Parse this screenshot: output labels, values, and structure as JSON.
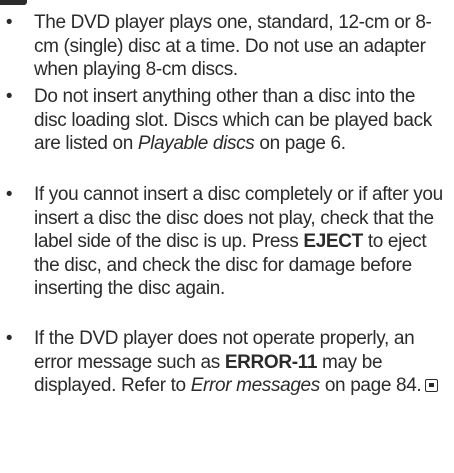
{
  "bullet_char": "•",
  "items": [
    {
      "text": "The DVD player plays one, standard, 12-cm or 8-cm (single) disc at a time. Do not use an adapter when playing 8-cm discs."
    },
    {
      "text_1": "Do not insert anything other than a disc into the disc loading slot. Discs which can be played back are listed on ",
      "ref": "Playable discs",
      "text_2": " on page 6."
    },
    {
      "text_1": "If you cannot insert a disc completely or if after you insert a disc the disc does not play, check that the label side of the disc is up. Press ",
      "bold": "EJECT",
      "text_2": " to eject the disc, and check the disc for damage before inserting the disc again."
    },
    {
      "text_1": "If the DVD player does not operate properly, an error message such as ",
      "bold": "ERROR-11",
      "text_2": " may be displayed. Refer to ",
      "ref": "Error messages",
      "text_3": " on page 84."
    }
  ],
  "end_icon": "end-of-section-icon"
}
